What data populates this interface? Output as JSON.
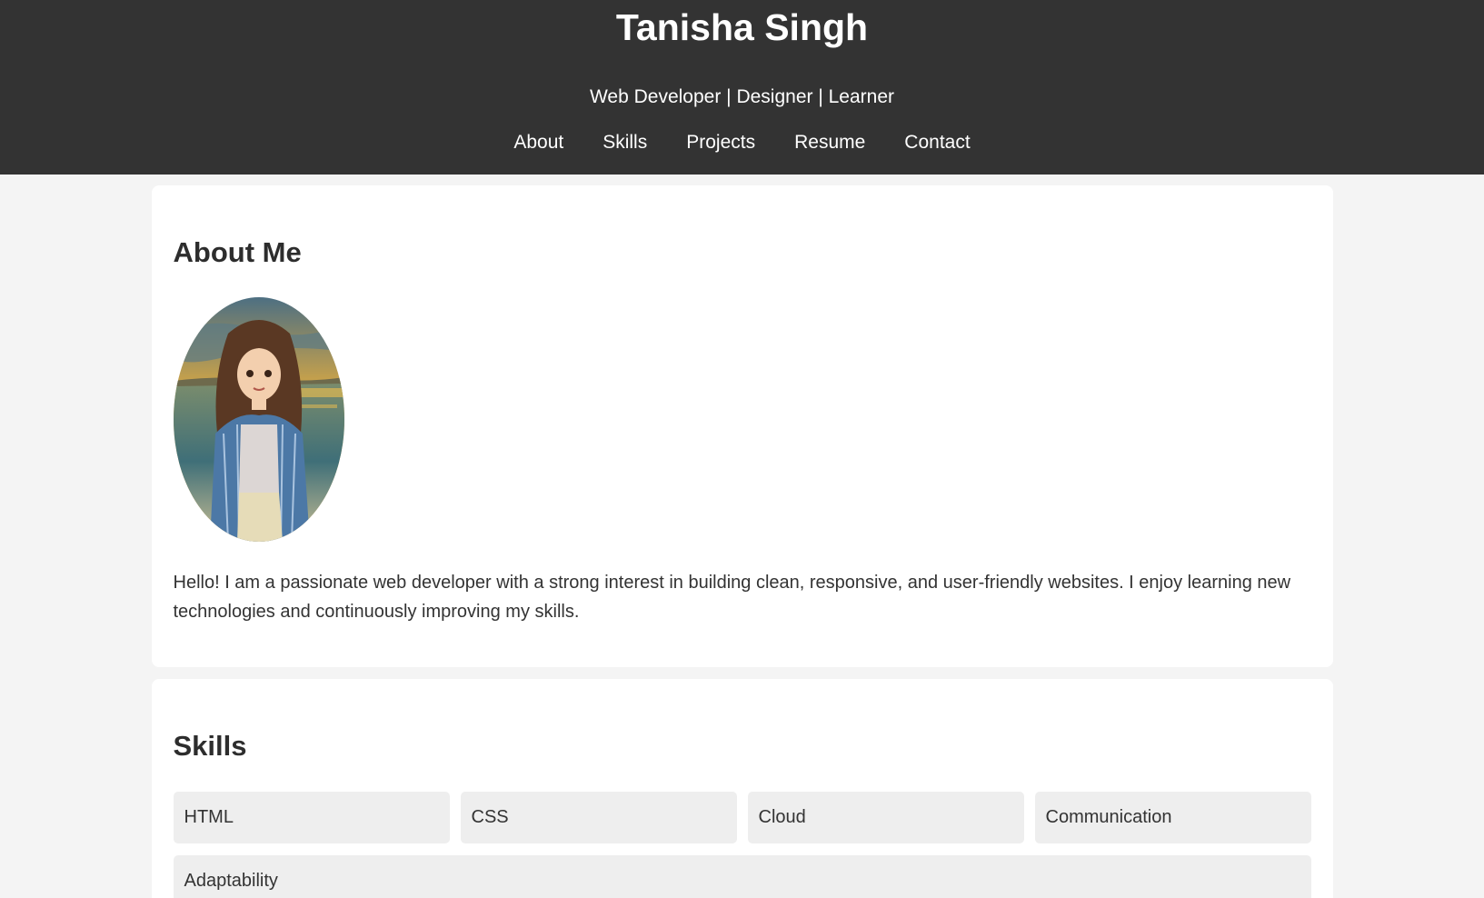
{
  "header": {
    "title": "Tanisha Singh",
    "tagline": "Web Developer | Designer | Learner",
    "nav": [
      "About",
      "Skills",
      "Projects",
      "Resume",
      "Contact"
    ]
  },
  "about": {
    "heading": "About Me",
    "text": "Hello! I am a passionate web developer with a strong interest in building clean, responsive, and user-friendly websites. I enjoy learning new technologies and continuously improving my skills."
  },
  "skills": {
    "heading": "Skills",
    "items": [
      "HTML",
      "CSS",
      "Cloud",
      "Communication",
      "Adaptability"
    ]
  },
  "colors": {
    "header_bg": "#333333",
    "page_bg": "#f4f4f4",
    "card_bg": "#ffffff",
    "skill_bg": "#eeeeee"
  }
}
